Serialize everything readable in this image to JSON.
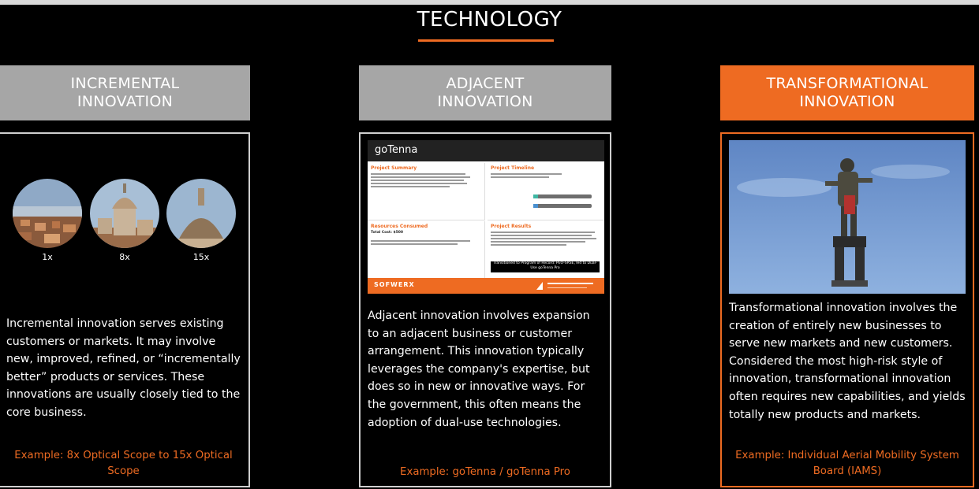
{
  "page": {
    "title": "TECHNOLOGY"
  },
  "columns": [
    {
      "header_line1": "INCREMENTAL",
      "header_line2": "INNOVATION",
      "zoom_labels": [
        "1x",
        "8x",
        "15x"
      ],
      "description": "Incremental innovation serves existing customers or markets. It may involve new, improved, refined, or “incrementally better” products or services. These innovations are usually closely tied to the core business.",
      "example": "Example: 8x Optical Scope to 15x Optical Scope"
    },
    {
      "header_line1": "ADJACENT",
      "header_line2": "INNOVATION",
      "poster": {
        "title": "goTenna",
        "q1_title": "Project Summary",
        "q2_title": "Project Timeline",
        "q3_title": "Resources Consumed",
        "q4_title": "Project Results",
        "total_cost": "Total Cost: $500",
        "banner": "Transitioned to Program of Record: PEO-SRSE, led to Dual-Use goTenna Pro",
        "logo_left": "SOFWERX"
      },
      "description": "Adjacent innovation involves expansion to an adjacent business or customer arrangement. This innovation typically leverages the company's expertise, but does so in new or innovative ways. For the government, this often means the adoption of dual-use technologies.",
      "example": "Example: goTenna / goTenna Pro"
    },
    {
      "header_line1": "TRANSFORMATIONAL",
      "header_line2": "INNOVATION",
      "description": "Transformational innovation involves the creation of entirely new businesses to serve new markets and new customers. Considered the most high-risk style of innovation, transformational innovation often requires new capabilities, and yields totally new products and markets.",
      "example": "Example: Individual Aerial Mobility System Board (IAMS)"
    }
  ],
  "colors": {
    "accent": "#ee6b22",
    "header_gray": "#a6a6a6",
    "card_border": "#cfcfcf"
  }
}
